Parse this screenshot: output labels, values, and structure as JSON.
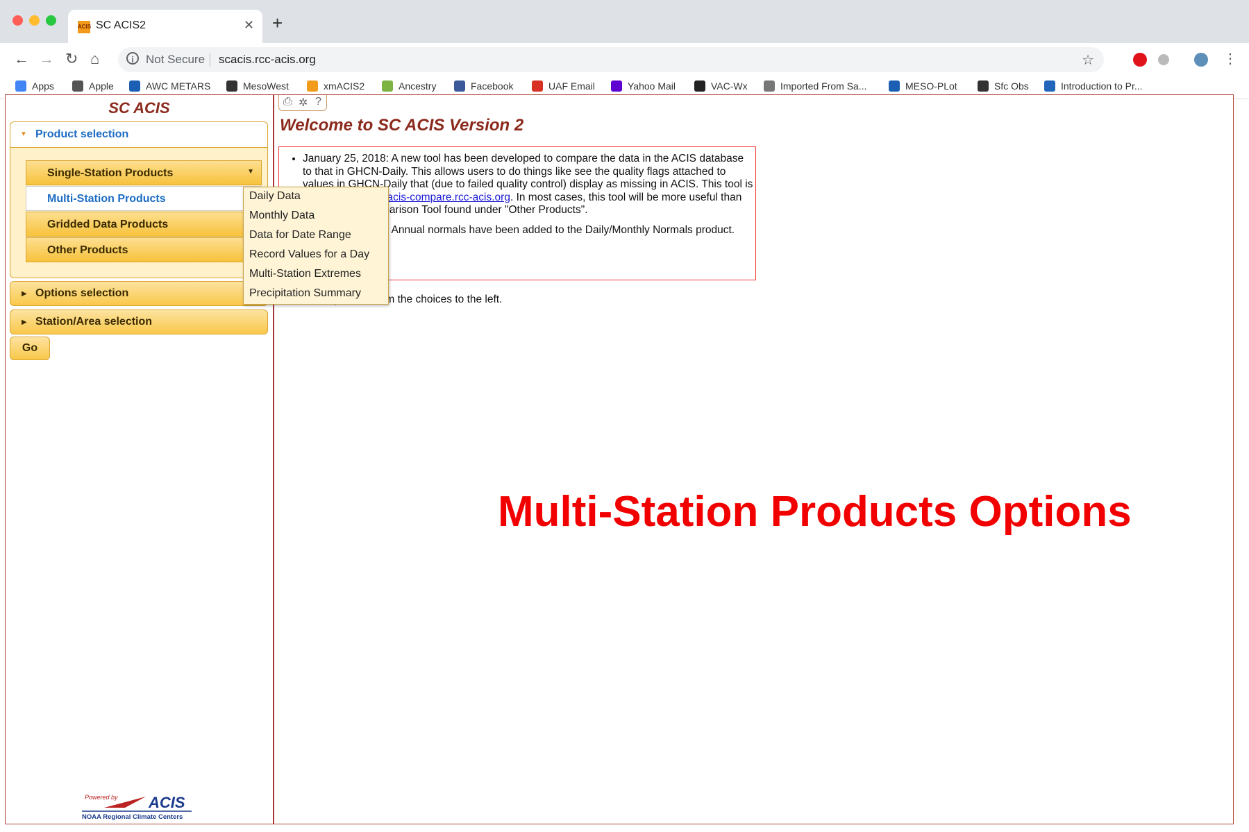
{
  "browser": {
    "tab_title": "SC ACIS2",
    "tab_favicon_text": "ACIS",
    "close_glyph": "✕",
    "newtab_glyph": "+",
    "not_secure": "Not Secure",
    "url": "scacis.rcc-acis.org",
    "bookmarks": [
      {
        "label": "Apps",
        "color": "#4285f4"
      },
      {
        "label": "Apple",
        "color": "#555555"
      },
      {
        "label": "AWC METARS",
        "color": "#1a5fb4"
      },
      {
        "label": "MesoWest",
        "color": "#333333"
      },
      {
        "label": "xmACIS2",
        "color": "#f29b1a"
      },
      {
        "label": "Ancestry",
        "color": "#7cb342"
      },
      {
        "label": "Facebook",
        "color": "#3b5998"
      },
      {
        "label": "UAF Email",
        "color": "#d93025"
      },
      {
        "label": "Yahoo Mail",
        "color": "#5f01d1"
      },
      {
        "label": "VAC-Wx",
        "color": "#222222"
      },
      {
        "label": "Imported From Sa...",
        "color": "#777777"
      },
      {
        "label": "MESO-PLot",
        "color": "#1a5fb4"
      },
      {
        "label": "Sfc Obs",
        "color": "#333333"
      },
      {
        "label": "Introduction to Pr...",
        "color": "#2266bb"
      }
    ]
  },
  "sidebar": {
    "title": "SC ACIS",
    "product_selection": "Product selection",
    "products": [
      "Single-Station Products",
      "Multi-Station Products",
      "Gridded Data Products",
      "Other Products"
    ],
    "options_selection": "Options selection",
    "station_selection": "Station/Area selection",
    "go": "Go",
    "powered_by": "Powered by",
    "acis": "ACIS",
    "rcc": "NOAA Regional Climate Centers"
  },
  "submenu": {
    "items": [
      "Daily Data",
      "Monthly Data",
      "Data for Date Range",
      "Record Values for a Day",
      "Multi-Station Extremes",
      "Precipitation Summary"
    ]
  },
  "main": {
    "welcome": "Welcome to SC ACIS Version 2",
    "news1_pre": "January 25, 2018: A new tool has been developed to compare the data in the ACIS database to that in GHCN-Daily. This allows users to do things like see the quality flags attached to values in GHCN-Daily that (due to failed quality control) display as missing in ACIS. This tool is available at ",
    "news1_link": "http://acis-compare.rcc-acis.org",
    "news1_post": ". In most cases, this tool will be more useful than the Dataset Comparison Tool found under \"Other Products\".",
    "news2": "January 12, 2018: Annual normals have been added to the Daily/Monthly Normals product.",
    "prompt": "Select a product from the choices to the left.",
    "overlay_label": "Multi-Station Products Options"
  },
  "colors": {
    "accent_red": "#f20000",
    "title_brown": "#8b2a1c",
    "link_blue": "#1c6cc4",
    "accordion_gold": "#f9c84a"
  }
}
